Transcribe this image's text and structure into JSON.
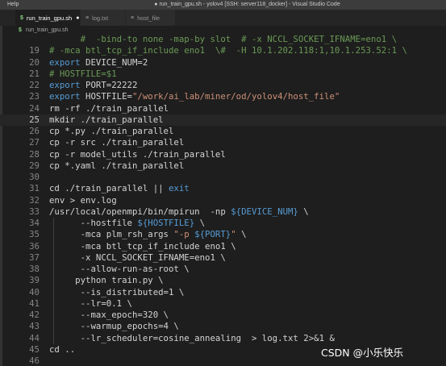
{
  "window": {
    "menu_help": "Help",
    "title": "● run_train_gpu.sh - yolov4 [SSH: server118_docker] - Visual Studio Code"
  },
  "tabs": [
    {
      "icon": "$",
      "label": "run_train_gpu.sh",
      "dirty": "●"
    },
    {
      "icon": "≡",
      "label": "log.txt"
    },
    {
      "icon": "≡",
      "label": "host_file"
    }
  ],
  "breadcrumb": {
    "icon": "$",
    "label": "run_train_gpu.sh"
  },
  "lines": [
    {
      "n": "",
      "text": "      #  -bind-to none -map-by slot  # -x NCCL_SOCKET_IFNAME=eno1 \\"
    },
    {
      "n": "19",
      "text": "# -mca btl_tcp_if_include eno1  \\#  -H 10.1.202.118:1,10.1.253.52:1 \\"
    },
    {
      "n": "20",
      "text": "export DEVICE_NUM=2"
    },
    {
      "n": "21",
      "text": "# HOSTFILE=$1"
    },
    {
      "n": "22",
      "text": "export PORT=22222"
    },
    {
      "n": "23",
      "text": "export HOSTFILE=\"/work/ai_lab/miner/od/yolov4/host_file\""
    },
    {
      "n": "24",
      "text": "rm -rf ./train_parallel"
    },
    {
      "n": "25",
      "text": "mkdir ./train_parallel"
    },
    {
      "n": "26",
      "text": "cp *.py ./train_parallel"
    },
    {
      "n": "27",
      "text": "cp -r src ./train_parallel"
    },
    {
      "n": "28",
      "text": "cp -r model_utils ./train_parallel"
    },
    {
      "n": "29",
      "text": "cp *.yaml ./train_parallel"
    },
    {
      "n": "30",
      "text": ""
    },
    {
      "n": "31",
      "text": "cd ./train_parallel || exit"
    },
    {
      "n": "32",
      "text": "env > env.log"
    },
    {
      "n": "33",
      "text": "/usr/local/openmpi/bin/mpirun  -np ${DEVICE_NUM} \\"
    },
    {
      "n": "34",
      "text": "      --hostfile ${HOSTFILE} \\"
    },
    {
      "n": "35",
      "text": "      -mca plm_rsh_args \"-p ${PORT}\" \\"
    },
    {
      "n": "36",
      "text": "      -mca btl_tcp_if_include eno1 \\"
    },
    {
      "n": "37",
      "text": "      -x NCCL_SOCKET_IFNAME=eno1 \\"
    },
    {
      "n": "38",
      "text": "      --allow-run-as-root \\"
    },
    {
      "n": "39",
      "text": "     python train.py \\"
    },
    {
      "n": "40",
      "text": "      --is_distributed=1 \\"
    },
    {
      "n": "41",
      "text": "      --lr=0.1 \\"
    },
    {
      "n": "42",
      "text": "      --max_epoch=320 \\"
    },
    {
      "n": "43",
      "text": "      --warmup_epochs=4 \\"
    },
    {
      "n": "44",
      "text": "      --lr_scheduler=cosine_annealing  > log.txt 2>&1 &"
    },
    {
      "n": "45",
      "text": "cd .."
    },
    {
      "n": "46",
      "text": ""
    }
  ],
  "current_line": "25",
  "watermark": "CSDN @小乐快乐",
  "colors": {
    "background": "#1e1e1e",
    "comment": "#6a9955",
    "keyword": "#569cd6",
    "string": "#ce9178",
    "text": "#d4d4d4",
    "line_number": "#858585"
  }
}
